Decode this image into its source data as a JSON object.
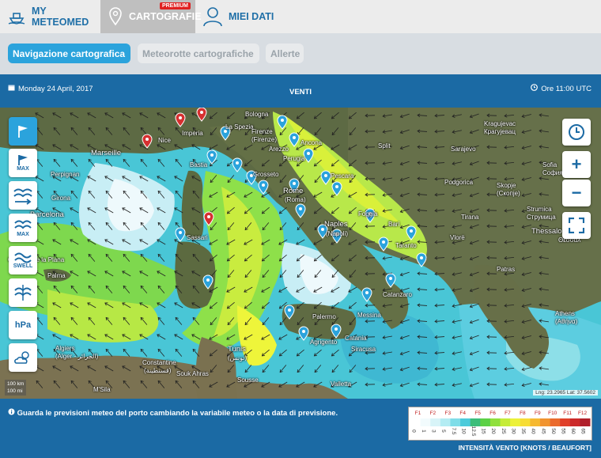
{
  "topnav": {
    "tabs": [
      {
        "label": "MY METEOMED",
        "icon": "ship-icon"
      },
      {
        "label": "CARTOGRAFIE",
        "icon": "map-pin-icon",
        "badge": "PREMIUM"
      },
      {
        "label": "MIEI DATI",
        "icon": "user-icon"
      }
    ]
  },
  "subnav": {
    "tabs": [
      "Navigazione cartografica",
      "Meteorotte cartografiche",
      "Allerte"
    ]
  },
  "bar": {
    "date": "Monday 24 April, 2017",
    "title": "VENTI",
    "hour": "Ore 11:00 UTC"
  },
  "map": {
    "left_controls": [
      {
        "name": "flag",
        "label": ""
      },
      {
        "name": "flag-max",
        "label": "MAX"
      },
      {
        "name": "wave-arrow",
        "label": ""
      },
      {
        "name": "wave-max",
        "label": "MAX"
      },
      {
        "name": "swell",
        "label": "SWELL"
      },
      {
        "name": "wave-split",
        "label": ""
      },
      {
        "name": "hpa",
        "label": "hPa"
      },
      {
        "name": "cloud-sun",
        "label": ""
      }
    ],
    "right_controls": [
      "clock",
      "+",
      "−",
      "fullscreen"
    ],
    "cities": [
      {
        "name": "Marseille",
        "big": true
      },
      {
        "name": "Nice"
      },
      {
        "name": "Imperia"
      },
      {
        "name": "La Spezia"
      },
      {
        "name": "Bologna"
      },
      {
        "name": "Firenze"
      },
      {
        "name": "(Firenze)"
      },
      {
        "name": "Ancona"
      },
      {
        "name": "Arezzo"
      },
      {
        "name": "Perugia"
      },
      {
        "name": "Perpignan"
      },
      {
        "name": "Girona"
      },
      {
        "name": "Barcelona",
        "big": true
      },
      {
        "name": "Bastia"
      },
      {
        "name": "Grosseto"
      },
      {
        "name": "Rome",
        "big": true
      },
      {
        "name": "(Roma)"
      },
      {
        "name": "Pescara"
      },
      {
        "name": "Foggia"
      },
      {
        "name": "Bari"
      },
      {
        "name": "Naples",
        "big": true
      },
      {
        "name": "(Napoli)"
      },
      {
        "name": "Taranto"
      },
      {
        "name": "Sassari"
      },
      {
        "name": "Castello de la Plana"
      },
      {
        "name": "Palma"
      },
      {
        "name": "Split"
      },
      {
        "name": "Sarajevo"
      },
      {
        "name": "Podgorica"
      },
      {
        "name": "Tirana"
      },
      {
        "name": "Vlorë"
      },
      {
        "name": "Kragujevac"
      },
      {
        "name": "Крагујевац"
      },
      {
        "name": "Sofia"
      },
      {
        "name": "София"
      },
      {
        "name": "Skopje"
      },
      {
        "name": "(Скопје)"
      },
      {
        "name": "Strumica"
      },
      {
        "name": "Струмица"
      },
      {
        "name": "Thessalo"
      },
      {
        "name": "Θεσσαλ"
      },
      {
        "name": "Athens"
      },
      {
        "name": "(Αθήνα)"
      },
      {
        "name": "Patras"
      },
      {
        "name": "Messina"
      },
      {
        "name": "Catanzaro"
      },
      {
        "name": "Palermo"
      },
      {
        "name": "Agrigento"
      },
      {
        "name": "Catania"
      },
      {
        "name": "Siracusa"
      },
      {
        "name": "Tunis"
      },
      {
        "name": "(تونس)"
      },
      {
        "name": "Algiers"
      },
      {
        "name": "(Alger - الجزائر)"
      },
      {
        "name": "Constantine"
      },
      {
        "name": "(قسنطينة)"
      },
      {
        "name": "Souk Ahras"
      },
      {
        "name": "Sousse"
      },
      {
        "name": "M'Sila"
      },
      {
        "name": "Valletta"
      }
    ],
    "scale": [
      "100 km",
      "100 mi"
    ],
    "coords": "Lng: 23.2965 Lat: 37.5602"
  },
  "footer": {
    "info": "Guarda le previsioni meteo del porto cambiando la variabile meteo o la data di previsione.",
    "legend_beaufort": [
      "F1",
      "F2",
      "F3",
      "F4",
      "F5",
      "F6",
      "F7",
      "F8",
      "F9",
      "F10",
      "F11",
      "F12"
    ],
    "legend_knots": [
      "0",
      "1",
      "3",
      "5",
      "7.5",
      "10",
      "12.5",
      "15",
      "20",
      "25",
      "30",
      "35",
      "40",
      "45",
      "50",
      "55",
      "60",
      "65"
    ],
    "legend_caption": "INTENSITÀ VENTO [KNOTS / BEAUFORT]"
  },
  "colors": {
    "header_blue": "#1b6aa4",
    "accent": "#2ba3dc",
    "premium_red": "#e02020"
  }
}
